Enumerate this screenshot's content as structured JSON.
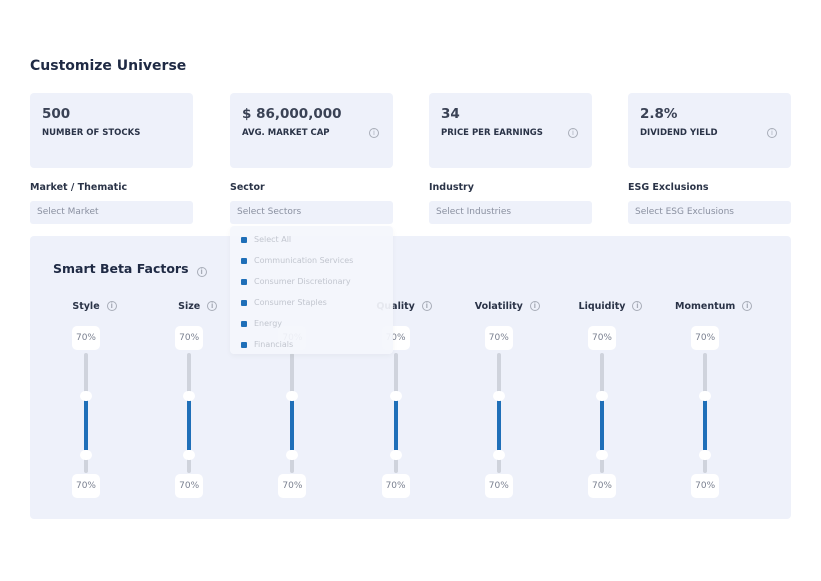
{
  "title": "Customize Universe",
  "stats": [
    {
      "value": "500",
      "label": "NUMBER OF STOCKS",
      "info": false
    },
    {
      "value": "$ 86,000,000",
      "label": "AVG. MARKET CAP",
      "info": true
    },
    {
      "value": "34",
      "label": "PRICE PER EARNINGS",
      "info": true
    },
    {
      "value": "2.8%",
      "label": "DIVIDEND YIELD",
      "info": true
    }
  ],
  "filters": [
    {
      "label": "Market / Thematic",
      "placeholder": "Select Market"
    },
    {
      "label": "Sector",
      "placeholder": "Select Sectors"
    },
    {
      "label": "Industry",
      "placeholder": "Select Industries"
    },
    {
      "label": "ESG Exclusions",
      "placeholder": "Select ESG Exclusions"
    }
  ],
  "sector_options": [
    "Select All",
    "Communication Services",
    "Consumer Discretionary",
    "Consumer Staples",
    "Energy",
    "Financials"
  ],
  "panel_title": "Smart Beta Factors",
  "factors": [
    {
      "name": "Style",
      "top": "70%",
      "bottom": "70%"
    },
    {
      "name": "Size",
      "top": "70%",
      "bottom": "70%"
    },
    {
      "name": "",
      "top": "70%",
      "bottom": "70%"
    },
    {
      "name": "Quality",
      "top": "70%",
      "bottom": "70%"
    },
    {
      "name": "Volatility",
      "top": "70%",
      "bottom": "70%"
    },
    {
      "name": "Liquidity",
      "top": "70%",
      "bottom": "70%"
    },
    {
      "name": "Momentum",
      "top": "70%",
      "bottom": "70%"
    }
  ],
  "colors": {
    "accent": "#1f6fb8",
    "card": "#eef1fa"
  },
  "info_icon": "ⓘ"
}
